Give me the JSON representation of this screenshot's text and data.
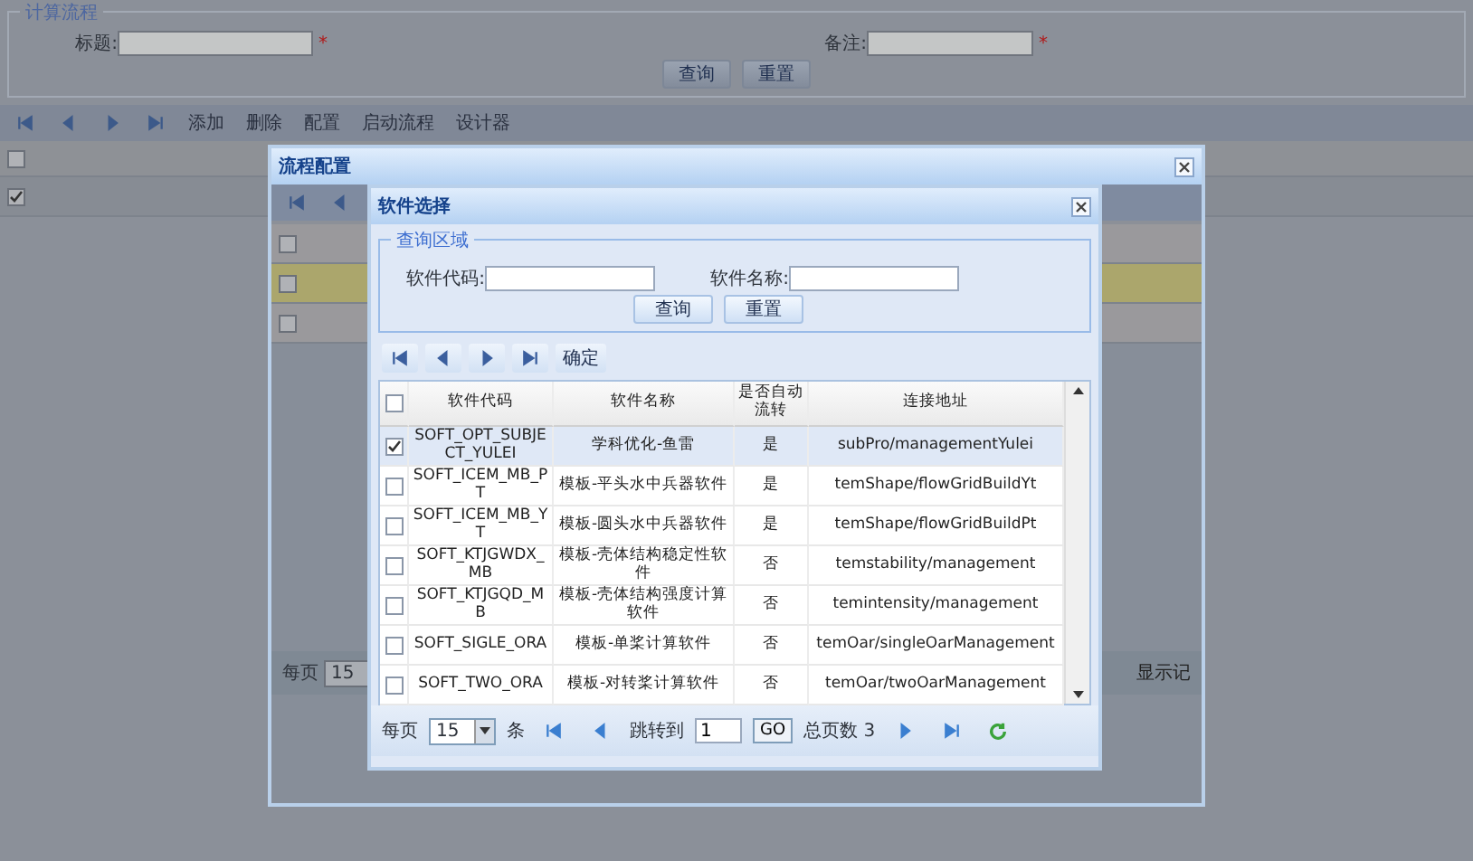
{
  "page": {
    "query": {
      "legend": "计算流程",
      "fields": [
        {
          "label": "标题:",
          "required_mark": "*"
        },
        {
          "label": "备注:",
          "required_mark": "*"
        }
      ],
      "buttons": [
        "查询",
        "重置"
      ]
    },
    "toolbar": {
      "buttons": [
        "添加",
        "删除",
        "配置",
        "启动流程",
        "设计器"
      ]
    },
    "grid": {
      "header_checked": false,
      "rows": [
        {
          "checked": true
        }
      ]
    }
  },
  "config_dialog": {
    "title": "流程配置",
    "grid": {
      "rows": [
        {
          "checked": false,
          "selected": false
        },
        {
          "checked": false,
          "selected": true
        },
        {
          "checked": false,
          "selected": false
        }
      ]
    },
    "pager": {
      "per_page_label": "每页",
      "per_page": "15",
      "status_text": "显示记"
    }
  },
  "software_dialog": {
    "title": "软件选择",
    "query": {
      "legend": "查询区域",
      "fields": [
        {
          "label": "软件代码:"
        },
        {
          "label": "软件名称:"
        }
      ],
      "buttons": [
        "查询",
        "重置"
      ]
    },
    "toolbar": {
      "button": "确定"
    },
    "table": {
      "header_checked": false,
      "columns": [
        "软件代码",
        "软件名称",
        "是否自动流转",
        "连接地址"
      ],
      "rows": [
        {
          "checked": true,
          "selected": true,
          "cells": [
            "SOFT_OPT_SUBJECT_YULEI",
            "学科优化-鱼雷",
            "是",
            "subPro/managementYulei"
          ]
        },
        {
          "checked": false,
          "selected": false,
          "cells": [
            "SOFT_ICEM_MB_PT",
            "模板-平头水中兵器软件",
            "是",
            "temShape/flowGridBuildYt"
          ]
        },
        {
          "checked": false,
          "selected": false,
          "cells": [
            "SOFT_ICEM_MB_YT",
            "模板-圆头水中兵器软件",
            "是",
            "temShape/flowGridBuildPt"
          ]
        },
        {
          "checked": false,
          "selected": false,
          "cells": [
            "SOFT_KTJGWDX_MB",
            "模板-壳体结构稳定性软件",
            "否",
            "temstability/management"
          ]
        },
        {
          "checked": false,
          "selected": false,
          "cells": [
            "SOFT_KTJGQD_MB",
            "模板-壳体结构强度计算软件",
            "否",
            "temintensity/management"
          ]
        },
        {
          "checked": false,
          "selected": false,
          "cells": [
            "SOFT_SIGLE_ORA",
            "模板-单桨计算软件",
            "否",
            "temOar/singleOarManagement"
          ]
        },
        {
          "checked": false,
          "selected": false,
          "cells": [
            "SOFT_TWO_ORA",
            "模板-对转桨计算软件",
            "否",
            "temOar/twoOarManagement"
          ]
        }
      ]
    },
    "pager": {
      "per_page_label": "每页",
      "per_page": "15",
      "unit": "条",
      "jump_label": "跳转到",
      "page": "1",
      "go": "GO",
      "total": "总页数 3"
    }
  }
}
